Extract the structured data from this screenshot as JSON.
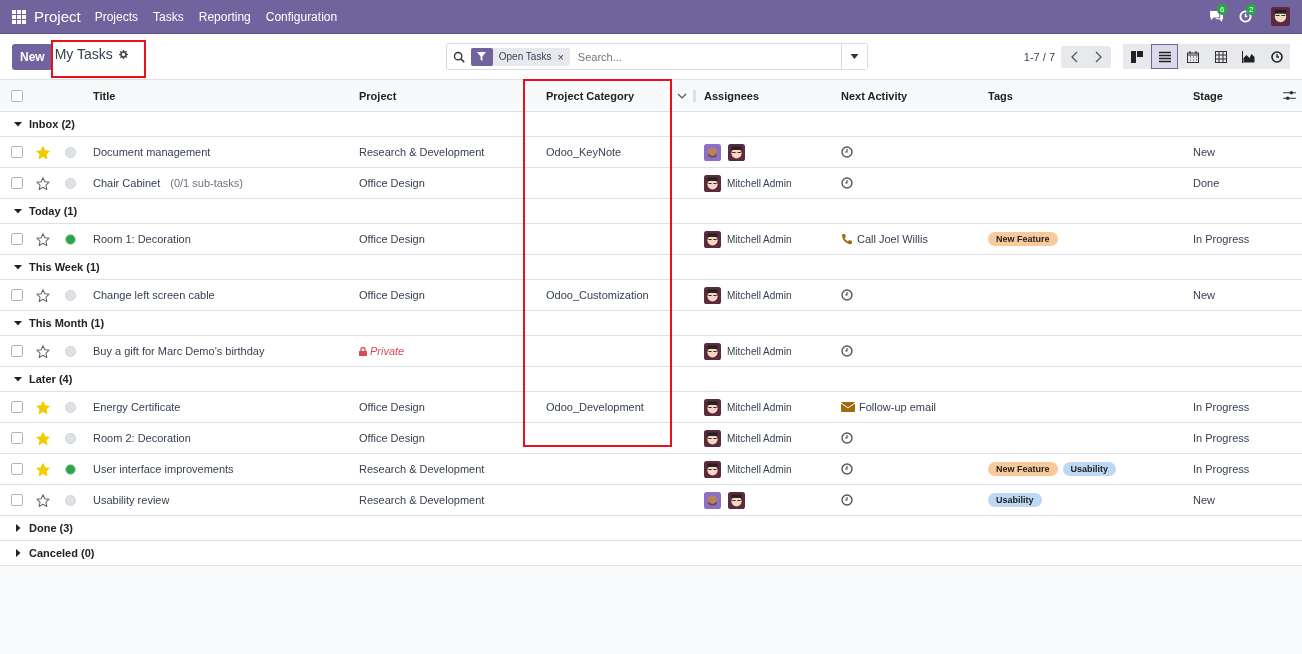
{
  "navbar": {
    "app": "Project",
    "menus": [
      "Projects",
      "Tasks",
      "Reporting",
      "Configuration"
    ],
    "messages_badge": "6",
    "activities_badge": "2"
  },
  "control_panel": {
    "new_button": "New",
    "title": "My Tasks",
    "search": {
      "facet": "Open Tasks",
      "remove": "×",
      "placeholder": "Search..."
    },
    "pager": "1-7 / 7",
    "views": [
      {
        "kind": "kanban",
        "selected": false
      },
      {
        "kind": "list",
        "selected": true
      },
      {
        "kind": "calendar",
        "selected": false
      },
      {
        "kind": "pivot",
        "selected": false
      },
      {
        "kind": "graph",
        "selected": false
      },
      {
        "kind": "activity",
        "selected": false
      }
    ]
  },
  "table": {
    "select_all_checked": false,
    "columns": [
      "Title",
      "Project",
      "Project Category",
      "Assignees",
      "Next Activity",
      "Tags",
      "Stage"
    ],
    "groups": [
      {
        "label": "Inbox (2)",
        "expanded": true,
        "tasks": [
          {
            "checked": false,
            "title": "Document management",
            "project": "Research & Development",
            "private": false,
            "category": "Odoo_KeyNote",
            "starred": true,
            "color": "#dee2e6",
            "assignees": [
              {
                "kind": "bearded"
              },
              {
                "kind": "glasses"
              }
            ],
            "activity": {
              "kind": "clock"
            },
            "stage": "New"
          },
          {
            "checked": false,
            "title": "Chair Cabinet",
            "note": "(0/1 sub-tasks)",
            "project": "Office Design",
            "private": false,
            "starred": false,
            "color": "#dee2e6",
            "assignees": [
              {
                "kind": "glasses"
              }
            ],
            "assignee_name": "Mitchell Admin",
            "activity": {
              "kind": "clock"
            },
            "stage": "Done"
          }
        ]
      },
      {
        "label": "Today (1)",
        "expanded": true,
        "tasks": [
          {
            "checked": false,
            "title": "Room 1: Decoration",
            "project": "Office Design",
            "private": false,
            "starred": false,
            "color": "#28a745",
            "assignees": [
              {
                "kind": "glasses"
              }
            ],
            "assignee_name": "Mitchell Admin",
            "activity": {
              "kind": "phone",
              "text": "Call Joel Willis"
            },
            "tags": [
              {
                "label": "New Feature",
                "color": "#f8c99a"
              }
            ],
            "stage": "In Progress"
          }
        ]
      },
      {
        "label": "This Week (1)",
        "expanded": true,
        "tasks": [
          {
            "checked": false,
            "title": "Change left screen cable",
            "project": "Office Design",
            "private": false,
            "category": "Odoo_Customization",
            "starred": false,
            "color": "#dee2e6",
            "assignees": [
              {
                "kind": "glasses"
              }
            ],
            "assignee_name": "Mitchell Admin",
            "activity": {
              "kind": "clock"
            },
            "stage": "New"
          }
        ]
      },
      {
        "label": "This Month (1)",
        "expanded": true,
        "tasks": [
          {
            "checked": false,
            "title": "Buy a gift for Marc Demo's birthday",
            "project": "Private",
            "private": true,
            "starred": false,
            "color": "#dee2e6",
            "assignees": [
              {
                "kind": "glasses"
              }
            ],
            "assignee_name": "Mitchell Admin",
            "activity": {
              "kind": "clock"
            }
          }
        ]
      },
      {
        "label": "Later (4)",
        "expanded": true,
        "tasks": [
          {
            "checked": false,
            "title": "Energy Certificate",
            "project": "Office Design",
            "private": false,
            "category": "Odoo_Development",
            "starred": true,
            "color": "#dee2e6",
            "assignees": [
              {
                "kind": "glasses"
              }
            ],
            "assignee_name": "Mitchell Admin",
            "activity": {
              "kind": "email",
              "text": "Follow-up email"
            },
            "stage": "In Progress"
          },
          {
            "checked": false,
            "title": "Room 2: Decoration",
            "project": "Office Design",
            "private": false,
            "starred": true,
            "color": "#dee2e6",
            "assignees": [
              {
                "kind": "glasses"
              }
            ],
            "assignee_name": "Mitchell Admin",
            "activity": {
              "kind": "clock"
            },
            "stage": "In Progress"
          },
          {
            "checked": false,
            "title": "User interface improvements",
            "project": "Research & Development",
            "private": false,
            "starred": true,
            "color": "#28a745",
            "assignees": [
              {
                "kind": "glasses"
              }
            ],
            "assignee_name": "Mitchell Admin",
            "activity": {
              "kind": "clock"
            },
            "tags": [
              {
                "label": "New Feature",
                "color": "#f8c99a"
              },
              {
                "label": "Usability",
                "color": "#bcd8f5"
              }
            ],
            "stage": "In Progress"
          },
          {
            "checked": false,
            "title": "Usability review",
            "project": "Research & Development",
            "private": false,
            "starred": false,
            "color": "#dee2e6",
            "assignees": [
              {
                "kind": "bearded"
              },
              {
                "kind": "glasses"
              }
            ],
            "activity": {
              "kind": "clock"
            },
            "tags": [
              {
                "label": "Usability",
                "color": "#bcd8f5"
              }
            ],
            "stage": "New"
          }
        ]
      },
      {
        "label": "Done (3)",
        "expanded": false
      },
      {
        "label": "Canceled (0)",
        "expanded": false
      }
    ]
  }
}
